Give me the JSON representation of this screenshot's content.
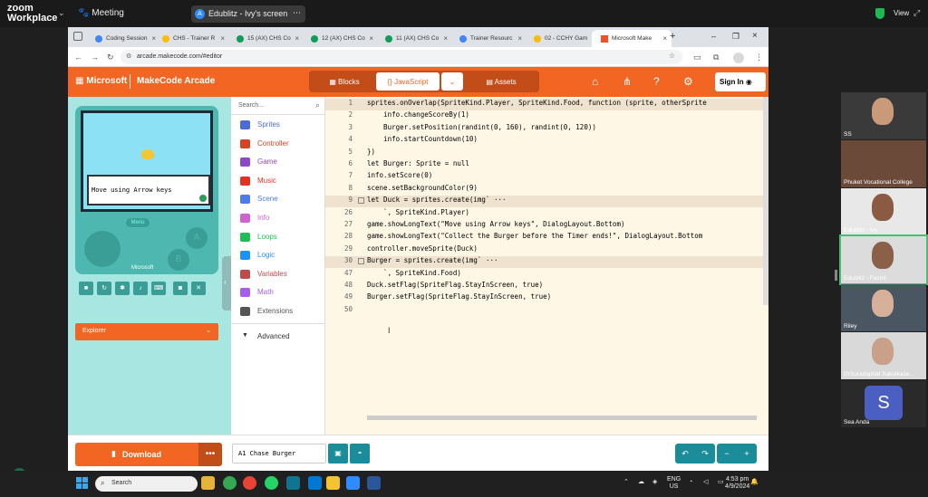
{
  "zoom": {
    "brand_top": "zoom",
    "brand_bottom": "Workplace",
    "meeting_label": "Meeting",
    "share_avatar": "A",
    "share_title": "Edublitz - Ivy's screen",
    "view_label": "View"
  },
  "browser": {
    "tabs": [
      {
        "label": "Coding Session"
      },
      {
        "label": "CHS - Trainer R"
      },
      {
        "label": "15 (AX) CHS Co"
      },
      {
        "label": "12 (AX) CHS Co"
      },
      {
        "label": "11 (AX) CHS Co"
      },
      {
        "label": "Trainer Resourc"
      },
      {
        "label": "02 - CCHY Gam"
      },
      {
        "label": "Microsoft Make"
      }
    ],
    "url": "arcade.makecode.com/#editor"
  },
  "makecode": {
    "microsoft": "Microsoft",
    "product": "MakeCode Arcade",
    "tab_blocks": "Blocks",
    "tab_javascript": "JavaScript",
    "tab_assets": "Assets",
    "sign_in": "Sign In",
    "dialog_text": "Move using Arrow keys",
    "menu_label": "Menu",
    "btn_a": "A",
    "btn_b": "B",
    "sim_brand": "Microsoft",
    "explorer": "Explorer",
    "search_placeholder": "Search...",
    "categories": [
      {
        "label": "Sprites",
        "color": "#4b6cd8"
      },
      {
        "label": "Controller",
        "color": "#d54322"
      },
      {
        "label": "Game",
        "color": "#8b48c9"
      },
      {
        "label": "Music",
        "color": "#e63022"
      },
      {
        "label": "Scene",
        "color": "#4b7bec"
      },
      {
        "label": "Info",
        "color": "#cf63cf"
      },
      {
        "label": "Loops",
        "color": "#20bf55"
      },
      {
        "label": "Logic",
        "color": "#1e90ff"
      },
      {
        "label": "Variables",
        "color": "#c04b4b"
      },
      {
        "label": "Math",
        "color": "#a55eea"
      },
      {
        "label": "Extensions",
        "color": "#555555"
      }
    ],
    "advanced": "Advanced",
    "code_lines": [
      {
        "n": "1",
        "text": "sprites.onOverlap(SpriteKind.Player, SpriteKind.Food, function (sprite, otherSprite"
      },
      {
        "n": "2",
        "text": "    info.changeScoreBy(1)"
      },
      {
        "n": "3",
        "text": "    Burger.setPosition(randint(0, 160), randint(0, 120))"
      },
      {
        "n": "4",
        "text": "    info.startCountdown(10)"
      },
      {
        "n": "5",
        "text": "})"
      },
      {
        "n": "6",
        "text": "let Burger: Sprite = null"
      },
      {
        "n": "7",
        "text": "info.setScore(0)"
      },
      {
        "n": "8",
        "text": "scene.setBackgroundColor(9)"
      },
      {
        "n": "9",
        "text": "let Duck = sprites.create(img` ···"
      },
      {
        "n": "26",
        "text": "    `, SpriteKind.Player)"
      },
      {
        "n": "27",
        "text": "game.showLongText(\"Move using Arrow keys\", DialogLayout.Bottom)"
      },
      {
        "n": "28",
        "text": "game.showLongText(\"Collect the Burger before the Timer ends!\", DialogLayout.Bottom"
      },
      {
        "n": "29",
        "text": "controller.moveSprite(Duck)"
      },
      {
        "n": "30",
        "text": "Burger = sprites.create(img` ···"
      },
      {
        "n": "47",
        "text": "    `, SpriteKind.Food)"
      },
      {
        "n": "48",
        "text": "Duck.setFlag(SpriteFlag.StayInScreen, true)"
      },
      {
        "n": "49",
        "text": "Burger.setFlag(SpriteFlag.StayInScreen, true)"
      },
      {
        "n": "50",
        "text": ""
      }
    ],
    "download": "Download",
    "download_more": "•••",
    "project_name": "A1 Chase Burger"
  },
  "participants": [
    {
      "name": "SS"
    },
    {
      "name": "Phuket Vocational College"
    },
    {
      "name": "Edublitz - Ivy"
    },
    {
      "name": "Edublitz - Fazmi"
    },
    {
      "name": "Riley"
    },
    {
      "name": "DrSuradaphat Sakulkase..."
    },
    {
      "name": "Sea Anda",
      "initial": "S"
    }
  ],
  "taskbar": {
    "search_placeholder": "Search",
    "lang_top": "ENG",
    "lang_bottom": "US",
    "time": "4:53 pm",
    "date": "4/9/2024"
  }
}
